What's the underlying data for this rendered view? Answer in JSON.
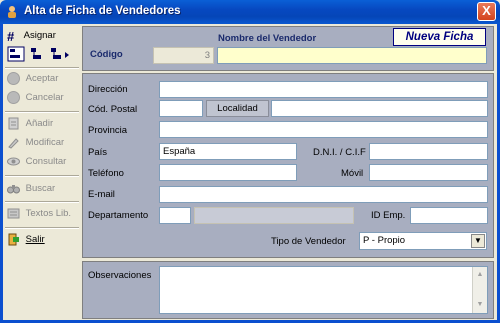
{
  "window": {
    "title": "Alta de Ficha de Vendedores",
    "close_glyph": "X"
  },
  "sidebar": {
    "asignar": {
      "glyph": "#",
      "label": "Asignar"
    },
    "aceptar": "Aceptar",
    "cancelar": "Cancelar",
    "anadir": "Añadir",
    "modificar": "Modificar",
    "consultar": "Consultar",
    "buscar": "Buscar",
    "textos": "Textos Lib.",
    "salir": "Salir"
  },
  "header": {
    "codigo_label": "Código",
    "codigo_value": "3",
    "nombre_header": "Nombre del Vendedor",
    "nombre_value": "",
    "mode_badge": "Nueva Ficha"
  },
  "form": {
    "direccion": {
      "label": "Dirección",
      "value": ""
    },
    "cod_postal": {
      "label": "Cód. Postal",
      "value": ""
    },
    "localidad": {
      "label": "Localidad",
      "value": ""
    },
    "provincia": {
      "label": "Provincia",
      "value": ""
    },
    "pais": {
      "label": "País",
      "value": "España"
    },
    "dni": {
      "label": "D.N.I. / C.I.F",
      "value": ""
    },
    "telefono": {
      "label": "Teléfono",
      "value": ""
    },
    "movil": {
      "label": "Móvil",
      "value": ""
    },
    "email": {
      "label": "E-mail",
      "value": ""
    },
    "departamento": {
      "label": "Departamento",
      "value": "",
      "desc": ""
    },
    "id_emp": {
      "label": "ID Emp.",
      "value": ""
    },
    "tipo_vendedor": {
      "label": "Tipo de Vendedor",
      "value": "P - Propio"
    }
  },
  "observaciones": {
    "label": "Observaciones",
    "value": ""
  },
  "colors": {
    "titlebar": "#0748c0",
    "panel": "#a8aec0",
    "accent": "#000080"
  }
}
